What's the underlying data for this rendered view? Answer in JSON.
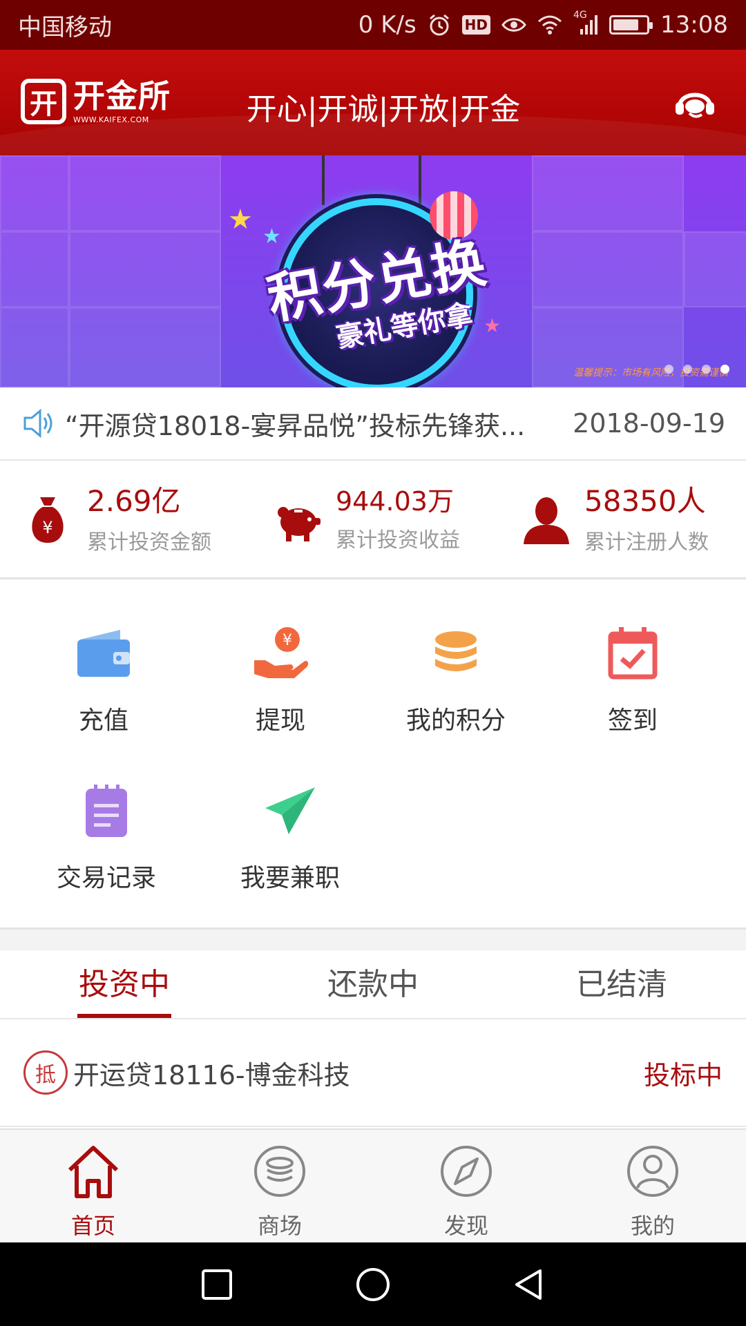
{
  "status_bar": {
    "carrier": "中国移动",
    "net_speed": "0 K/s",
    "hd_badge": "HD",
    "network_type": "4G",
    "time": "13:08",
    "icons": [
      "alarm-icon",
      "hd-icon",
      "eye-icon",
      "wifi-icon",
      "signal-icon",
      "battery-icon"
    ]
  },
  "header": {
    "logo_name": "开金所",
    "logo_mark": "开",
    "logo_url": "WWW.KAIFEX.COM",
    "slogan": "开心|开诚|开放|开金",
    "service_icon": "customer-service-icon"
  },
  "banner": {
    "title": "积分兑换",
    "subtitle": "豪礼等你拿",
    "tip": "温馨提示：市场有风险，投资需谨慎",
    "slide_count": 4,
    "active_slide": 4
  },
  "notice": {
    "icon": "speaker-icon",
    "text": "“开源贷18018-宴昇品悦”投标先锋获...",
    "date": "2018-09-19"
  },
  "stats": [
    {
      "icon": "money-bag-icon",
      "value": "2.69亿",
      "label": "累计投资金额"
    },
    {
      "icon": "piggy-bank-icon",
      "value": "944.03万",
      "label": "累计投资收益"
    },
    {
      "icon": "user-icon",
      "value": "58350人",
      "label": "累计注册人数"
    }
  ],
  "quick_actions": [
    {
      "icon": "wallet-icon",
      "label": "充值",
      "color": "#5b9ded"
    },
    {
      "icon": "withdraw-icon",
      "label": "提现",
      "color": "#f2683e"
    },
    {
      "icon": "coins-icon",
      "label": "我的积分",
      "color": "#f4a24a"
    },
    {
      "icon": "calendar-check-icon",
      "label": "签到",
      "color": "#ee5a5a"
    },
    {
      "icon": "notepad-icon",
      "label": "交易记录",
      "color": "#a77be6"
    },
    {
      "icon": "paper-plane-icon",
      "label": "我要兼职",
      "color": "#3ccf8e"
    }
  ],
  "tabs": [
    {
      "label": "投资中",
      "active": true
    },
    {
      "label": "还款中",
      "active": false
    },
    {
      "label": "已结清",
      "active": false
    }
  ],
  "list": [
    {
      "tag": "抵",
      "title": "开运贷18116-博金科技",
      "status": "投标中"
    }
  ],
  "bottom_nav": [
    {
      "icon": "home-icon",
      "label": "首页",
      "active": true
    },
    {
      "icon": "mall-icon",
      "label": "商场",
      "active": false
    },
    {
      "icon": "compass-icon",
      "label": "发现",
      "active": false
    },
    {
      "icon": "profile-icon",
      "label": "我的",
      "active": false
    }
  ],
  "colors": {
    "brand_red": "#a80d0d",
    "header_red": "#b20606",
    "status_bar": "#6f0000"
  }
}
